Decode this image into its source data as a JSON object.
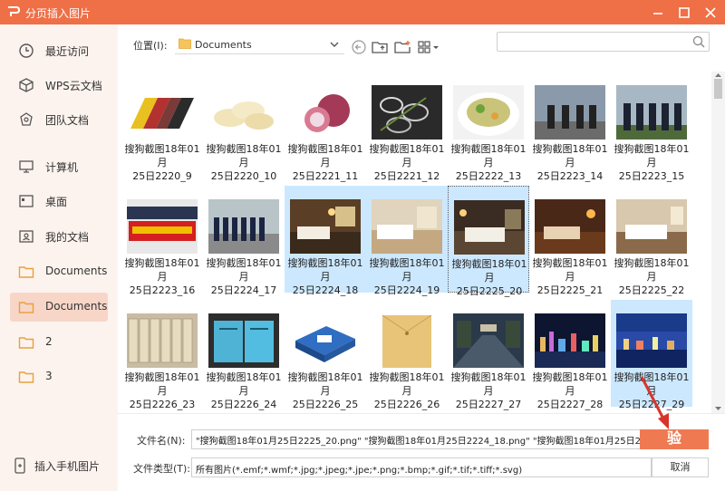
{
  "titlebar": {
    "title": "分页插入图片",
    "logo_icon": "wps-logo-icon",
    "accent": "#ef6f47"
  },
  "sidebar": {
    "items": [
      {
        "label": "最近访问",
        "icon": "clock-icon"
      },
      {
        "label": "WPS云文档",
        "icon": "cloud-box-icon"
      },
      {
        "label": "团队文档",
        "icon": "team-icon"
      },
      {
        "label": "计算机",
        "icon": "monitor-icon"
      },
      {
        "label": "桌面",
        "icon": "desktop-icon"
      },
      {
        "label": "我的文档",
        "icon": "my-docs-icon"
      },
      {
        "label": "Documents",
        "icon": "folder-icon"
      },
      {
        "label": "Documents",
        "icon": "folder-icon",
        "active": true
      },
      {
        "label": "2",
        "icon": "folder-icon"
      },
      {
        "label": "3",
        "icon": "folder-icon"
      }
    ],
    "mobile_label": "插入手机图片"
  },
  "toolbar": {
    "location_label": "位置(I):",
    "location_value": "Documents",
    "search_placeholder": ""
  },
  "files": [
    {
      "line1": "搜狗截图18年01月",
      "line2": "25日2220_9",
      "scene": "cards"
    },
    {
      "line1": "搜狗截图18年01月",
      "line2": "25日2220_10",
      "scene": "potato"
    },
    {
      "line1": "搜狗截图18年01月",
      "line2": "25日2221_11",
      "scene": "onion"
    },
    {
      "line1": "搜狗截图18年01月",
      "line2": "25日2221_12",
      "scene": "rings"
    },
    {
      "line1": "搜狗截图18年01月",
      "line2": "25日2222_13",
      "scene": "dish"
    },
    {
      "line1": "搜狗截图18年01月",
      "line2": "25日2223_14",
      "scene": "guards"
    },
    {
      "line1": "搜狗截图18年01月",
      "line2": "25日2223_15",
      "scene": "guards2"
    },
    {
      "line1": "搜狗截图18年01月",
      "line2": "25日2223_16",
      "scene": "banner"
    },
    {
      "line1": "搜狗截图18年01月",
      "line2": "25日2224_17",
      "scene": "lineup"
    },
    {
      "line1": "搜狗截图18年01月",
      "line2": "25日2224_18",
      "scene": "hotel",
      "selected": true
    },
    {
      "line1": "搜狗截图18年01月",
      "line2": "25日2224_19",
      "scene": "hotel2",
      "selected": true
    },
    {
      "line1": "搜狗截图18年01月",
      "line2": "25日2225_20",
      "scene": "hotel3",
      "selected": true,
      "focused": true
    },
    {
      "line1": "搜狗截图18年01月",
      "line2": "25日2225_21",
      "scene": "hotel4"
    },
    {
      "line1": "搜狗截图18年01月",
      "line2": "25日2225_22",
      "scene": "hotel5"
    },
    {
      "line1": "搜狗截图18年01月",
      "line2": "25日2226_23",
      "scene": "archive"
    },
    {
      "line1": "搜狗截图18年01月",
      "line2": "25日2226_24",
      "scene": "bluebook"
    },
    {
      "line1": "搜狗截图18年01月",
      "line2": "25日2226_25",
      "scene": "bluebox"
    },
    {
      "line1": "搜狗截图18年01月",
      "line2": "25日2226_26",
      "scene": "envelope"
    },
    {
      "line1": "搜狗截图18年01月",
      "line2": "25日2227_27",
      "scene": "street"
    },
    {
      "line1": "搜狗截图18年01月",
      "line2": "25日2227_28",
      "scene": "night"
    },
    {
      "line1": "搜狗截图18年01月",
      "line2": "25日2227_29",
      "scene": "night2",
      "selected": true
    }
  ],
  "bottom": {
    "filename_label": "文件名(N):",
    "filename_value": "\"搜狗截图18年01月25日2225_20.png\" \"搜狗截图18年01月25日2224_18.png\" \"搜狗截图18年01月25日2",
    "open_label": "验",
    "filetype_label": "文件类型(T):",
    "filetype_value": "所有图片(*.emf;*.wmf;*.jpg;*.jpeg;*.jpe;*.png;*.bmp;*.gif;*.tif;*.tiff;*.svg)",
    "cancel_label": "取消"
  }
}
